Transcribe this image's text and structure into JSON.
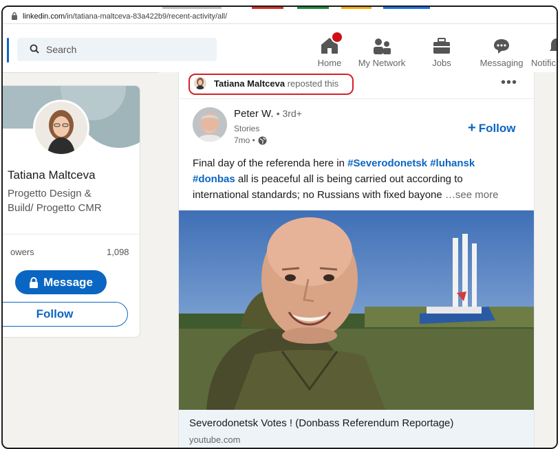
{
  "browser": {
    "url_host": "linkedin.com",
    "url_path": "/in/tatiana-maltceva-83a422b9/recent-activity/all/"
  },
  "nav": {
    "search_placeholder": "Search",
    "items": [
      {
        "label": "Home",
        "icon": "home-icon"
      },
      {
        "label": "My Network",
        "icon": "network-icon"
      },
      {
        "label": "Jobs",
        "icon": "briefcase-icon"
      },
      {
        "label": "Messaging",
        "icon": "messaging-icon"
      },
      {
        "label": "Notific",
        "icon": "bell-icon"
      }
    ]
  },
  "profile": {
    "name": "Tatiana Maltceva",
    "headline_line1": "Progetto Design &",
    "headline_line2": "Build/ Progetto CMR",
    "followers_label": "owers",
    "followers_count": "1,098",
    "message_button": "Message",
    "follow_button": "Follow"
  },
  "post": {
    "reposter_name": "Tatiana Maltceva",
    "repost_suffix": "reposted this",
    "more_menu": "•••",
    "author_name": "Peter W.",
    "author_degree": "• 3rd+",
    "author_sub": "Stories",
    "author_time": "7mo •",
    "follow_label": "Follow",
    "text": {
      "p1": "Final day of the referenda here in ",
      "tag1": "#Severodonetsk",
      "tag2": "#luhansk",
      "tag3": "#donbas",
      "p2": " all is peaceful all is being carried out according to",
      "line3": "international standards; no Russians with fixed bayone",
      "see_more": "…see more"
    },
    "link_title": "Severodonetsk Votes ! (Donbass Referendum Reportage)",
    "link_domain": "youtube.com"
  },
  "colors": {
    "brand_blue": "#0a66c2",
    "highlight_red": "#d61f26",
    "page_bg": "#f3f2ef"
  }
}
